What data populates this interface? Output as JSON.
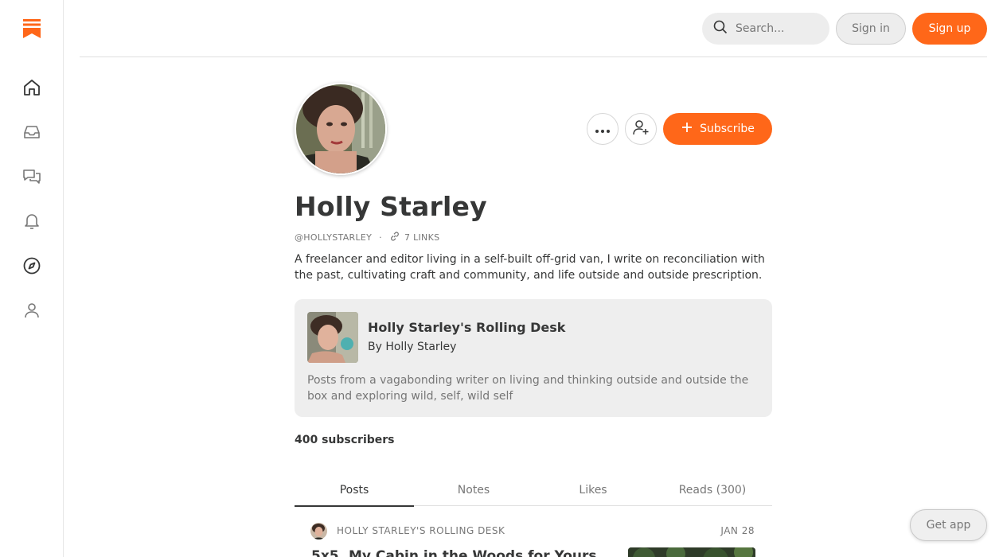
{
  "brand": {
    "accent": "#ff6719",
    "logo_icon": "bookmark-logo-icon"
  },
  "sidebar": {
    "items": [
      {
        "icon": "home-icon"
      },
      {
        "icon": "inbox-icon"
      },
      {
        "icon": "chat-icon"
      },
      {
        "icon": "bell-icon"
      },
      {
        "icon": "compass-icon"
      },
      {
        "icon": "user-icon"
      }
    ]
  },
  "header": {
    "search_placeholder": "Search...",
    "signin_label": "Sign in",
    "signup_label": "Sign up"
  },
  "profile": {
    "name": "Holly Starley",
    "handle": "@HOLLYSTARLEY",
    "separator": "·",
    "links_label": "7 LINKS",
    "bio": "A freelancer and editor living in a self-built off-grid van, I write on reconciliation with the past, cultivating craft and community, and life outside and outside prescription.",
    "subscribe_label": "Subscribe",
    "subscribers": "400 subscribers"
  },
  "publication": {
    "title": "Holly Starley's Rolling Desk",
    "byline": "By Holly Starley",
    "description": "Posts from a vagabonding writer on living and thinking outside and outside the box and exploring wild, self, wild self"
  },
  "tabs": [
    {
      "label": "Posts",
      "active": true
    },
    {
      "label": "Notes"
    },
    {
      "label": "Likes"
    },
    {
      "label": "Reads (300)"
    }
  ],
  "post": {
    "publication": "HOLLY STARLEY'S ROLLING DESK",
    "date": "JAN 28",
    "title": "5x5, My Cabin in the Woods for Yours"
  },
  "get_app_label": "Get app"
}
